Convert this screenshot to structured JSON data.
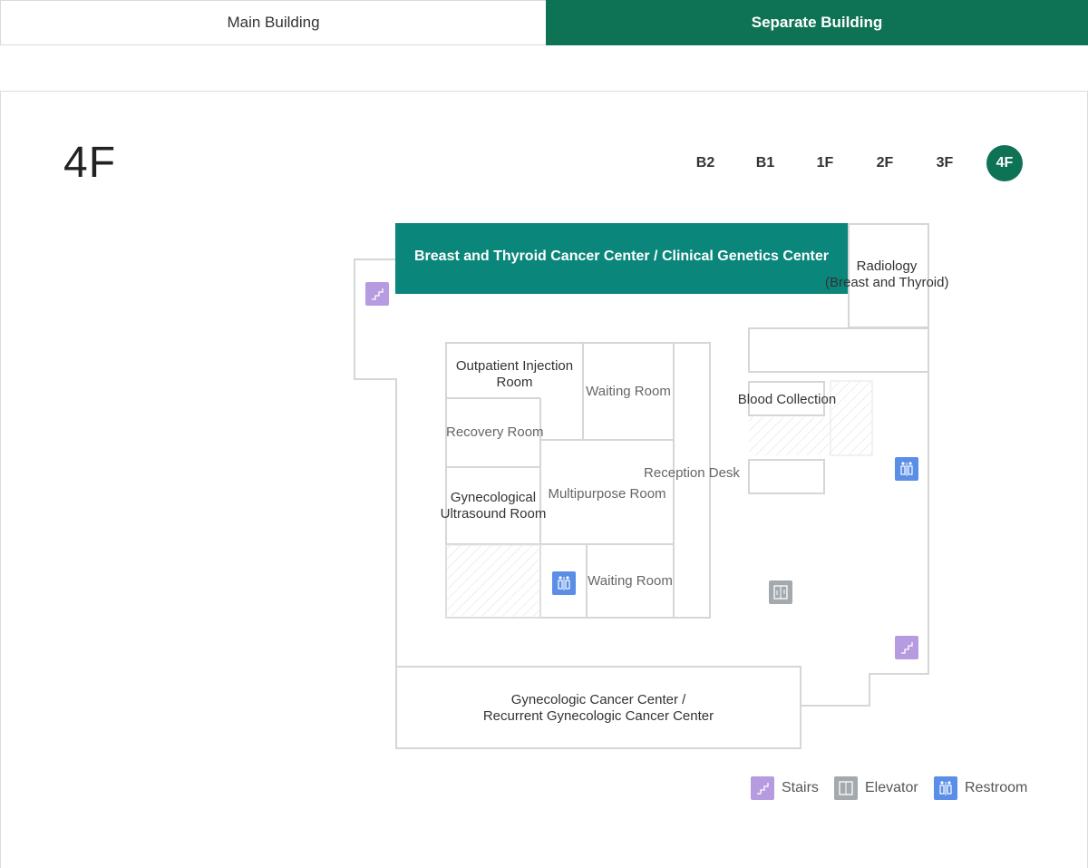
{
  "tabs": {
    "main": "Main Building",
    "separate": "Separate Building"
  },
  "floor": {
    "title": "4F",
    "buttons": [
      "B2",
      "B1",
      "1F",
      "2F",
      "3F",
      "4F"
    ],
    "active": "4F"
  },
  "rooms": {
    "breast_center": "Breast and Thyroid Cancer Center / Clinical Genetics Center",
    "radiology_line1": "Radiology",
    "radiology_line2": "(Breast and Thyroid)",
    "outpatient_injection_line1": "Outpatient Injection",
    "outpatient_injection_line2": "Room",
    "waiting_room_top": "Waiting Room",
    "recovery_room": "Recovery Room",
    "multipurpose_room": "Multipurpose Room",
    "reception_desk": "Reception Desk",
    "blood_collection": "Blood Collection",
    "gyn_ultrasound_line1": "Gynecological",
    "gyn_ultrasound_line2": "Ultrasound Room",
    "waiting_room_bottom": "Waiting Room",
    "gyn_cancer_line1": "Gynecologic Cancer Center /",
    "gyn_cancer_line2": "Recurrent Gynecologic Cancer Center"
  },
  "legend": {
    "stairs": "Stairs",
    "elevator": "Elevator",
    "restroom": "Restroom"
  },
  "colors": {
    "brand_green": "#0e7355",
    "highlight_teal": "#0a867a",
    "stairs": "#b79be0",
    "elevator": "#a3a9ad",
    "restroom": "#5b8ee6"
  }
}
